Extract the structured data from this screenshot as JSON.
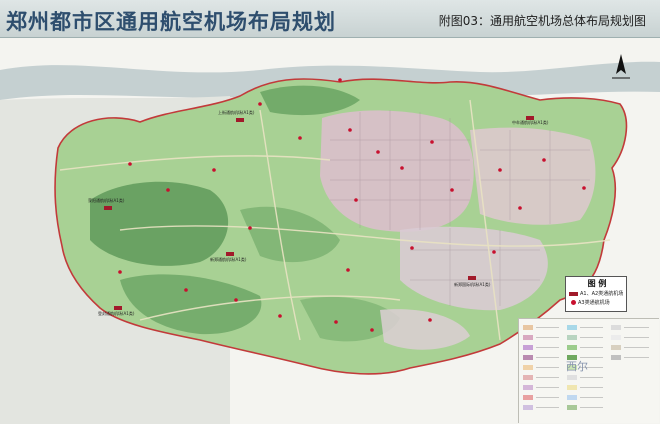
{
  "header": {
    "title": "郑州都市区通用航空机场布局规划",
    "subtitle": "附图03：通用航空机场总体布局规划图"
  },
  "legend": {
    "title": "图 例",
    "items": [
      {
        "label": "A1、A2类通航机场",
        "symbol": "red-rect"
      },
      {
        "label": "A3类通航机场",
        "symbol": "red-dot"
      }
    ]
  },
  "map_labels": [
    {
      "text": "上街通航机场(A1类)"
    },
    {
      "text": "荥阳通航机场(A1类)"
    },
    {
      "text": "新郑通航机场(A1类)"
    },
    {
      "text": "登封通航机场(A1类)"
    },
    {
      "text": "中牟通航机场(A1类)"
    },
    {
      "text": "新郑国际机场(A1类)"
    }
  ],
  "watermark": "西尔",
  "north_arrow": {
    "label": "N",
    "icon": "north-arrow-icon"
  },
  "colors": {
    "header_bg": "#d3dcdc",
    "title_text": "#2e4e6e",
    "river": "#b9c7c9",
    "forest": "#5f9a5a",
    "farmland": "#a9d196",
    "urban": "#d7b8c8",
    "airport": "#a11a2a",
    "boundary": "#c23a3a"
  }
}
